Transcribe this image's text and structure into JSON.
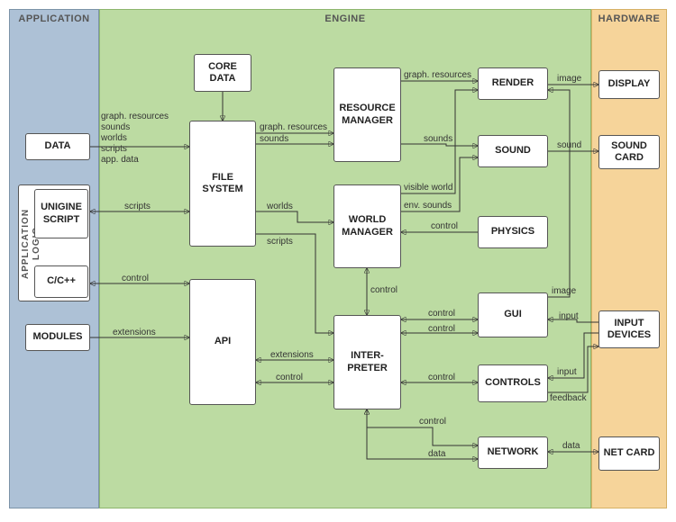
{
  "columns": {
    "application": "APPLICATION",
    "engine": "ENGINE",
    "hardware": "HARDWARE"
  },
  "blocks": {
    "data": "DATA",
    "app_logic": "APPLICATION LOGIC",
    "unigine_script": "UNIGINE SCRIPT",
    "ccpp": "C/C++",
    "modules": "MODULES",
    "core_data": "CORE DATA",
    "file_system": "FILE SYSTEM",
    "api": "API",
    "resource_manager": "RESOURCE MANAGER",
    "world_manager": "WORLD MANAGER",
    "interpreter": "INTER-PRETER",
    "render": "RENDER",
    "sound": "SOUND",
    "physics": "PHYSICS",
    "gui": "GUI",
    "controls": "CONTROLS",
    "network": "NETWORK",
    "display": "DISPLAY",
    "sound_card": "SOUND CARD",
    "input_devices": "INPUT DEVICES",
    "net_card": "NET CARD"
  },
  "edges": {
    "data_fs": "graph. resources\nsounds\nworlds\nscripts\napp. data",
    "script_fs": "scripts",
    "ccpp_api": "control",
    "modules_api": "extensions",
    "coredata_fs": "",
    "fs_rm_sounds": "sounds",
    "fs_rm_graph": "graph. resources",
    "fs_wm": "worlds",
    "fs_interp": "scripts",
    "api_interp_ext": "extensions",
    "api_interp_ctrl": "control",
    "rm_render": "graph. resources",
    "rm_sound": "sounds",
    "wm_render": "visible world",
    "wm_sound": "env. sounds",
    "physics_wm": "control",
    "gui_render": "image",
    "gui_interp": "control",
    "wm_interp": "control",
    "controls_interp": "control",
    "network_interp_ctrl": "control",
    "network_interp_data": "data",
    "render_display": "image",
    "sound_sc": "sound",
    "gui_input": "input",
    "controls_input": "input",
    "controls_feedback": "feedback",
    "network_netcard": "data"
  }
}
